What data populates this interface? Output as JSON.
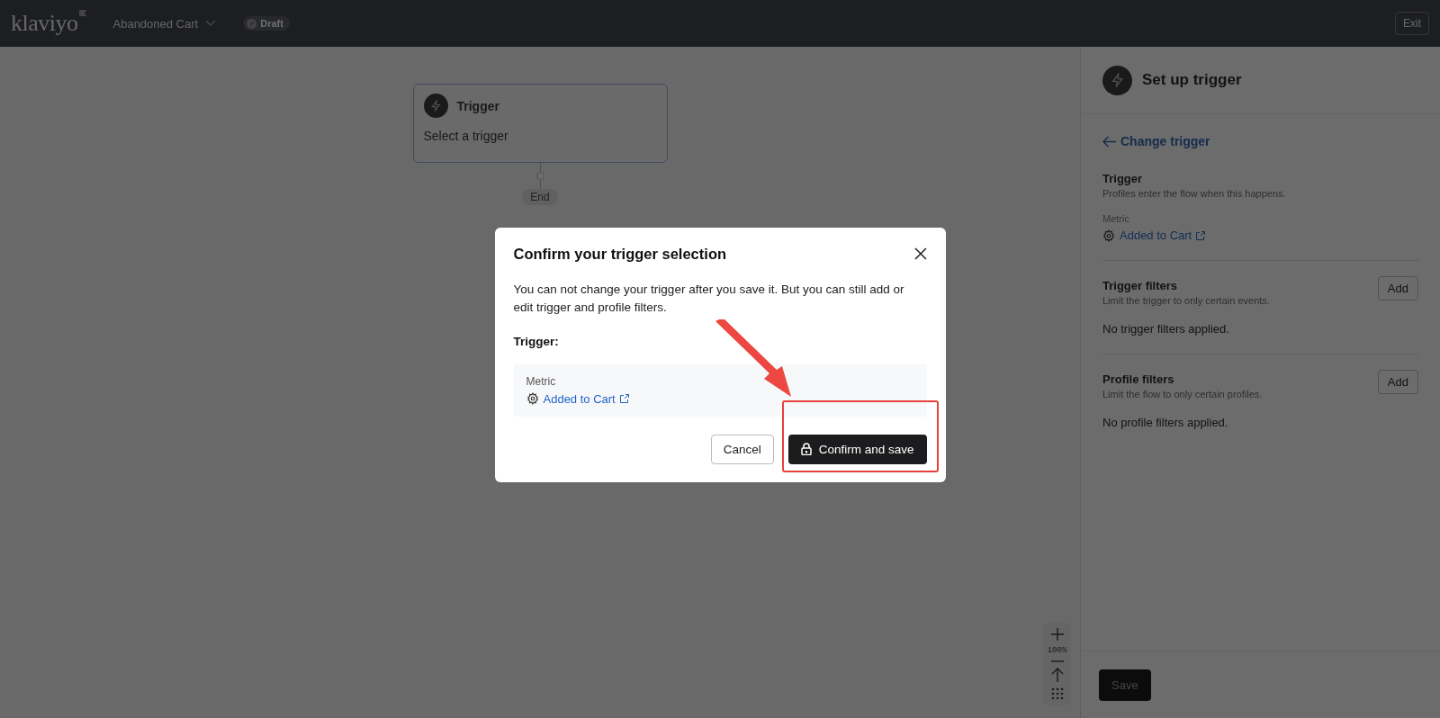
{
  "topbar": {
    "logo": "klaviyo",
    "flow_name": "Abandoned Cart",
    "status_badge": "Draft",
    "exit_button": "Exit"
  },
  "canvas": {
    "trigger_node": {
      "title": "Trigger",
      "subtitle": "Select a trigger"
    },
    "end_label": "End",
    "zoom_level": "100%"
  },
  "panel": {
    "title": "Set up trigger",
    "back_link": "Change trigger",
    "trigger": {
      "heading": "Trigger",
      "description": "Profiles enter the flow when this happens.",
      "metric_label": "Metric",
      "metric_link": "Added to Cart"
    },
    "sections": [
      {
        "heading": "Trigger filters",
        "description": "Limit the trigger to only certain events.",
        "button": "Add",
        "empty_text": "No trigger filters applied."
      },
      {
        "heading": "Profile filters",
        "description": "Limit the flow to only certain profiles.",
        "button": "Add",
        "empty_text": "No profile filters applied."
      }
    ],
    "save_button": "Save"
  },
  "modal": {
    "title": "Confirm your trigger selection",
    "body": "You can not change your trigger after you save it. But you can still add or edit trigger and profile filters.",
    "trigger_label": "Trigger:",
    "metric_label": "Metric",
    "metric_link": "Added to Cart",
    "cancel_button": "Cancel",
    "confirm_button": "Confirm and save"
  }
}
